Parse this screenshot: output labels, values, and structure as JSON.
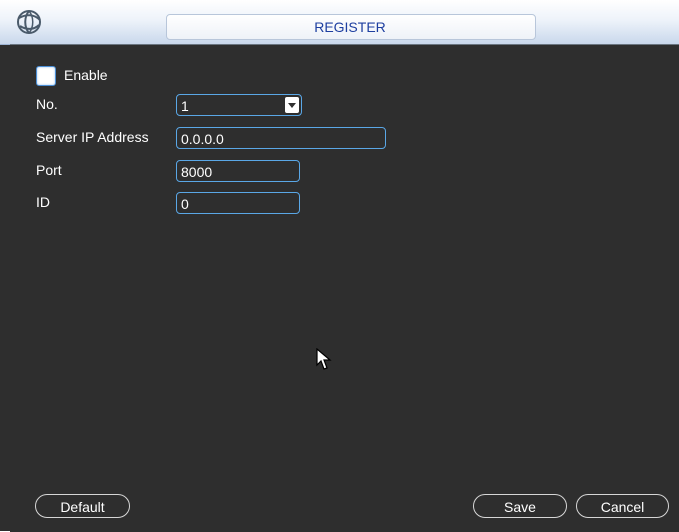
{
  "window": {
    "title": "REGISTER",
    "logo_icon": "globe-logo-icon"
  },
  "form": {
    "enable": {
      "label": "Enable",
      "checked": false
    },
    "no": {
      "label": "No.",
      "value": "1"
    },
    "server_ip": {
      "label": "Server IP Address",
      "value": "0.0.0.0"
    },
    "port": {
      "label": "Port",
      "value": "8000"
    },
    "id": {
      "label": "ID",
      "value": "0"
    }
  },
  "buttons": {
    "default": "Default",
    "save": "Save",
    "cancel": "Cancel"
  },
  "colors": {
    "background": "#2e2e2e",
    "title_text": "#1e3fa0",
    "field_border": "#5aa7e6",
    "text": "#ffffff"
  },
  "pointer": {
    "icon": "mouse-pointer-icon"
  }
}
